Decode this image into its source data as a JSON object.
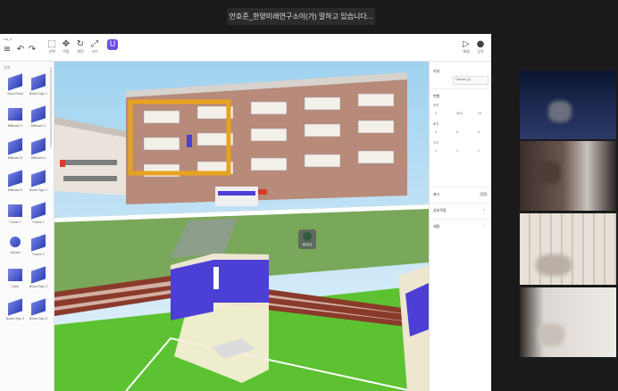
{
  "meeting": {
    "speaker_banner": "안호준_한양미래연구소이(가) 말하고 있습니다..."
  },
  "editor": {
    "filename": "...rs_1",
    "toolbar": {
      "undo_icon": "undo-icon",
      "redo_icon": "redo-icon",
      "tools": [
        {
          "label": "선택"
        },
        {
          "label": "이동"
        },
        {
          "label": "회전"
        },
        {
          "label": "크기"
        },
        {
          "label": "U"
        }
      ],
      "play_label": "재생",
      "share_label": "공유"
    },
    "library": {
      "search_label": "검색",
      "assets": [
        "Solar Panel",
        "Board Sign 1",
        "Billboard 1",
        "Billboard 2",
        "Billboard 3",
        "Billboard 4",
        "Billboard 5",
        "Board Sign 2",
        "Frame 1",
        "Frame 2",
        "Sphere",
        "Frame 3",
        "Cube",
        "Board Sign 3",
        "Board Sign 4",
        "Board Sign 5"
      ]
    },
    "properties": {
      "title": "속성",
      "object_name": "Canvas (1)",
      "transform_label": "변형",
      "position_label": "위치",
      "position": [
        "0",
        "36.9",
        "10"
      ],
      "rotation_label": "회전",
      "rotation": [
        "0",
        "0",
        "0"
      ],
      "scale_label": "크기",
      "scale": [
        "1",
        "1",
        "1"
      ],
      "visibility_label": "표시",
      "interaction_label": "상호작용",
      "material_label": "재질"
    },
    "scene": {
      "booth_sign": "에듀테크"
    }
  },
  "colors": {
    "accent": "#6b4de6",
    "grass": "#62c837",
    "track": "#8a3a2a",
    "building": "#b88a7a",
    "booth_panel": "#4b3fd6"
  }
}
